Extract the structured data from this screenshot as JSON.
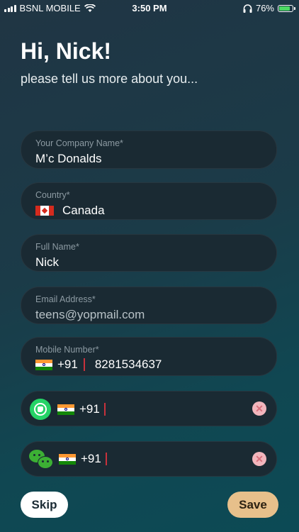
{
  "status_bar": {
    "carrier": "BSNL MOBILE",
    "time": "3:50 PM",
    "battery": "76%",
    "battery_level": 0.76,
    "colors": {
      "battery_fill": "#4cd964"
    }
  },
  "header": {
    "title": "Hi, Nick!",
    "subtitle": "please tell us more about you..."
  },
  "form": {
    "company": {
      "label": "Your Company Name*",
      "value": "M’c Donalds"
    },
    "country": {
      "label": "Country*",
      "value": "Canada",
      "flag_icon": "canada-flag-icon"
    },
    "full_name": {
      "label": "Full Name*",
      "value": "Nick"
    },
    "email": {
      "label": "Email Address*",
      "value": "teens@yopmail.com"
    },
    "mobile": {
      "label": "Mobile Number*",
      "code": "+91",
      "value": "8281534637",
      "flag_icon": "india-flag-icon"
    },
    "whatsapp": {
      "code": "+91",
      "value": "",
      "icon": "whatsapp-icon",
      "clear_icon": "clear-icon"
    },
    "wechat": {
      "code": "+91",
      "value": "",
      "icon": "wechat-icon",
      "clear_icon": "clear-icon"
    }
  },
  "actions": {
    "skip_label": "Skip",
    "save_label": "Save",
    "colors": {
      "save": "#e7c08b",
      "skip": "#ffffff"
    }
  },
  "colors": {
    "field_bg": "#1a2a33",
    "accent_cursor": "#c8323c",
    "label": "#8c9aa2"
  }
}
